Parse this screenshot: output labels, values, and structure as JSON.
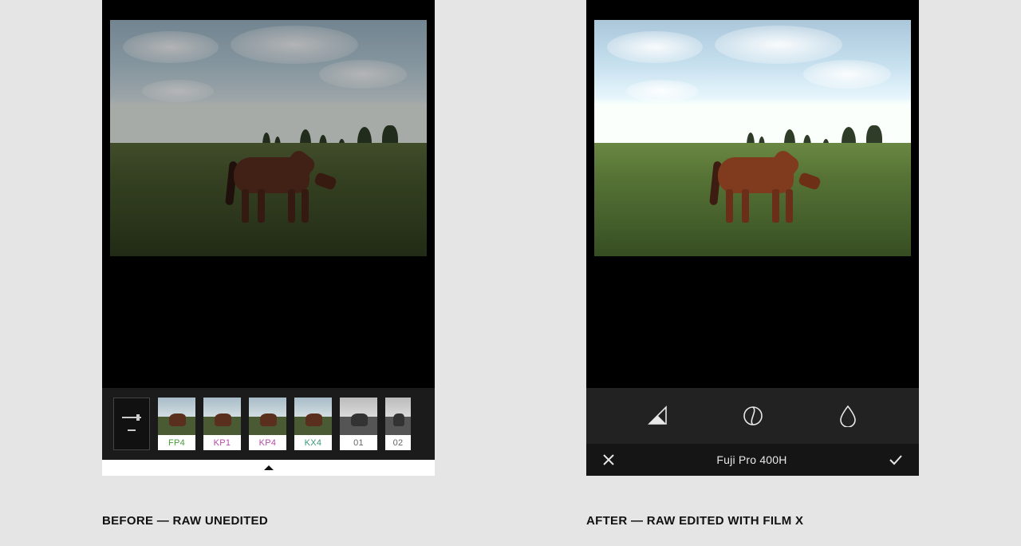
{
  "before": {
    "caption": "BEFORE — RAW UNEDITED",
    "presets": [
      {
        "code": "FP4",
        "colorClass": "c-green",
        "bw": false
      },
      {
        "code": "KP1",
        "colorClass": "c-magenta",
        "bw": false
      },
      {
        "code": "KP4",
        "colorClass": "c-magenta",
        "bw": false
      },
      {
        "code": "KX4",
        "colorClass": "c-teal",
        "bw": false
      },
      {
        "code": "01",
        "colorClass": "c-gray",
        "bw": true
      },
      {
        "code": "02",
        "colorClass": "c-gray",
        "bw": true
      }
    ]
  },
  "after": {
    "caption": "AFTER — RAW EDITED WITH FILM X",
    "preset_title": "Fuji Pro 400H",
    "tools": [
      {
        "name": "adjust-exposure-icon"
      },
      {
        "name": "contrast-icon"
      },
      {
        "name": "saturation-icon"
      }
    ]
  }
}
